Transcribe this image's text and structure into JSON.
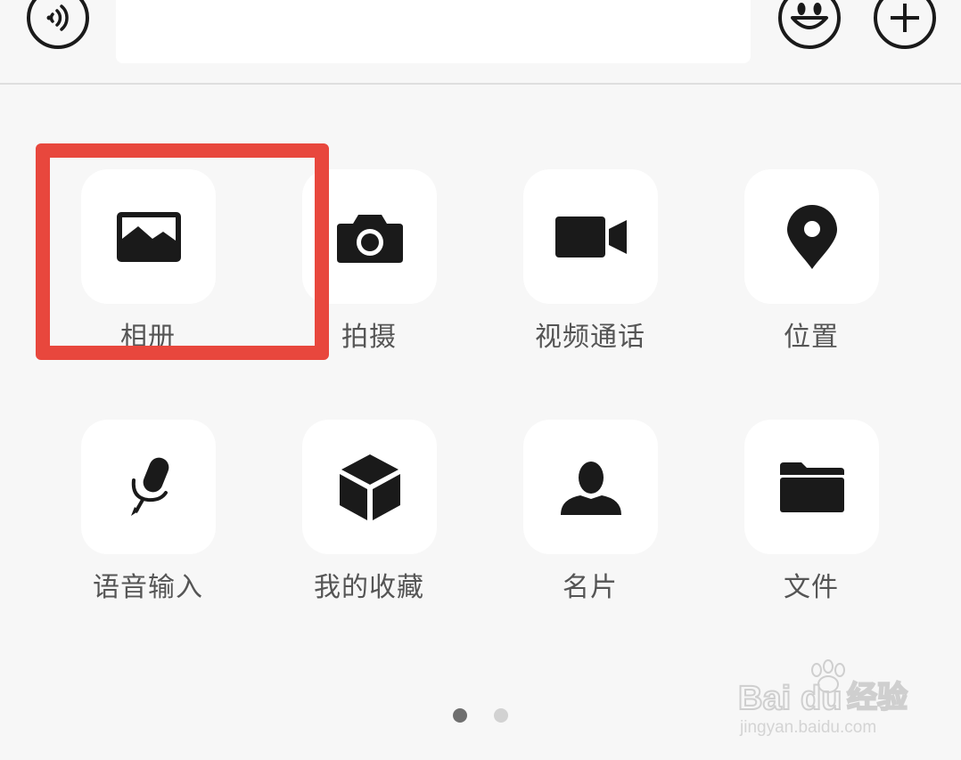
{
  "panel": {
    "items": [
      {
        "label": "相册",
        "icon": "photo-icon"
      },
      {
        "label": "拍摄",
        "icon": "camera-icon"
      },
      {
        "label": "视频通话",
        "icon": "video-camera-icon"
      },
      {
        "label": "位置",
        "icon": "location-pin-icon"
      },
      {
        "label": "语音输入",
        "icon": "microphone-icon"
      },
      {
        "label": "我的收藏",
        "icon": "cube-icon"
      },
      {
        "label": "名片",
        "icon": "person-icon"
      },
      {
        "label": "文件",
        "icon": "folder-icon"
      }
    ]
  },
  "toolbar": {
    "voice_icon": "voice-icon",
    "emoji_icon": "emoji-icon",
    "plus_icon": "plus-icon"
  },
  "pager": {
    "pages": 2,
    "current": 1
  },
  "colors": {
    "background": "#f7f7f7",
    "tile": "#ffffff",
    "icon": "#1a1a1a",
    "label": "#555555",
    "highlight": "#e8473d"
  },
  "watermark": {
    "brand": "Bai du 经验",
    "url": "jingyan.baidu.com"
  }
}
